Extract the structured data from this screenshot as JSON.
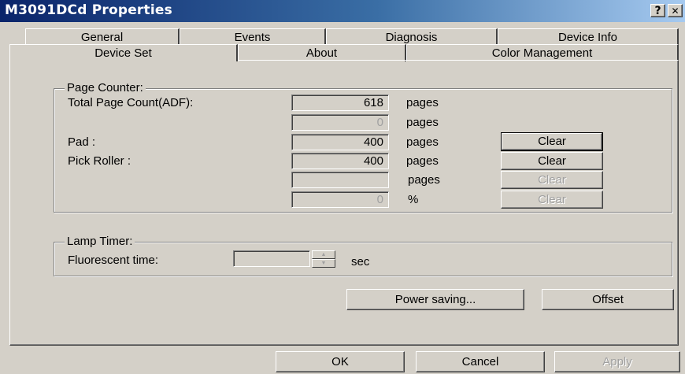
{
  "window": {
    "title": "M3091DCd Properties",
    "help_label": "?",
    "close_label": "✕"
  },
  "tabs": {
    "row1": [
      "General",
      "Events",
      "Diagnosis",
      "Device Info"
    ],
    "row2": [
      "Device Set",
      "About",
      "Color Management"
    ],
    "selected": "Device Set"
  },
  "page_counter": {
    "legend": "Page Counter:",
    "rows": [
      {
        "label": "Total Page Count(ADF):",
        "value": "618",
        "unit": "pages",
        "enabled": true,
        "clear": null
      },
      {
        "label": "",
        "value": "0",
        "unit": "pages",
        "enabled": false,
        "clear": null
      },
      {
        "label": "Pad :",
        "value": "400",
        "unit": "pages",
        "enabled": true,
        "clear": "Clear"
      },
      {
        "label": "Pick Roller :",
        "value": "400",
        "unit": "pages",
        "enabled": true,
        "clear": "Clear"
      },
      {
        "label": "",
        "value": "",
        "unit": "pages",
        "enabled": false,
        "clear": "Clear"
      },
      {
        "label": "",
        "value": "0",
        "unit": "%",
        "enabled": false,
        "clear": "Clear"
      }
    ]
  },
  "lamp_timer": {
    "legend": "Lamp Timer:",
    "label": "Fluorescent time:",
    "value": "",
    "unit": "sec",
    "spin_up_icon": "▲",
    "spin_down_icon": "▼"
  },
  "actions": {
    "power_saving": "Power saving...",
    "offset": "Offset"
  },
  "footer": {
    "ok": "OK",
    "cancel": "Cancel",
    "apply": "Apply"
  }
}
